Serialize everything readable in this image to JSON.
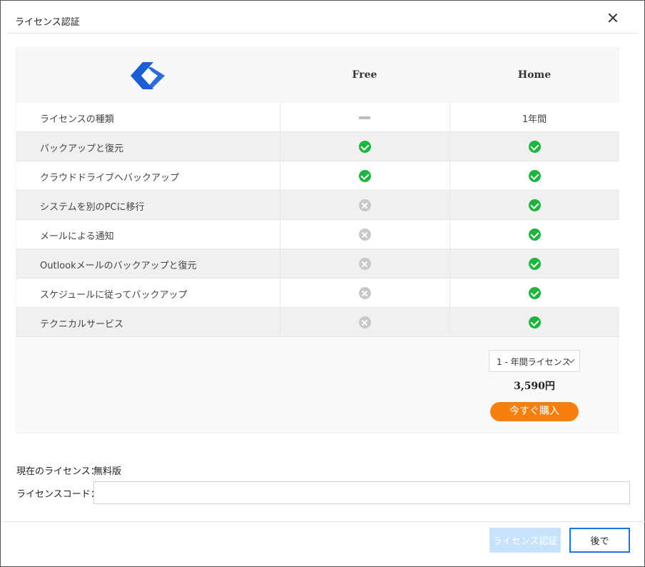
{
  "window": {
    "title": "ライセンス認証",
    "close_icon": "close-icon"
  },
  "colors": {
    "accent": "#1a73e8",
    "buy": "#f67f0d",
    "check": "#1fb33f",
    "cross": "#c8c8c8",
    "auth_disabled": "#c7e3fb",
    "logo": "#1a5fd6"
  },
  "table": {
    "logo_icon": "easeus-logo-icon",
    "columns": [
      "Free",
      "Home"
    ],
    "first_row": {
      "label": "ライセンスの種類",
      "free": "dash",
      "home_text": "1年間"
    },
    "features": [
      {
        "label": "バックアップと復元",
        "free": "check",
        "home": "check"
      },
      {
        "label": "クラウドドライブへバックアップ",
        "free": "check",
        "home": "check"
      },
      {
        "label": "システムを別のPCに移行",
        "free": "cross",
        "home": "check"
      },
      {
        "label": "メールによる通知",
        "free": "cross",
        "home": "check"
      },
      {
        "label": "Outlookメールのバックアップと復元",
        "free": "cross",
        "home": "check"
      },
      {
        "label": "スケジュールに従ってバックアップ",
        "free": "cross",
        "home": "check"
      },
      {
        "label": "テクニカルサービス",
        "free": "cross",
        "home": "check"
      }
    ]
  },
  "purchase": {
    "license_select": "1 - 年間ライセンス",
    "price": "3,590円",
    "buy_label": "今すぐ購入"
  },
  "license": {
    "current_label": "現在のライセンス：",
    "current_value": "無料版",
    "code_label": "ライセンスコード：",
    "code_value": "",
    "code_placeholder": ""
  },
  "footer": {
    "auth_label": "ライセンス認証",
    "later_label": "後で"
  }
}
